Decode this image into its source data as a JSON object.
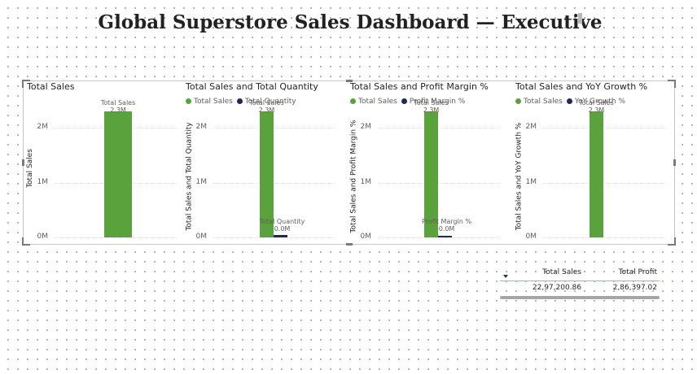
{
  "page": {
    "title": "Global Superstore Sales Dashboard — Executive"
  },
  "colors": {
    "sales": "#5aa33c",
    "secondary": "#1f2a56",
    "accent_line": "#9cc489"
  },
  "charts": [
    {
      "title": "Total Sales",
      "ylabel": "Total Sales",
      "legend": [],
      "ticks": [
        "2M",
        "1M",
        "0M"
      ],
      "bar_labels": [
        "Total Sales",
        "",
        ""
      ],
      "bar_values": [
        "2.3M",
        "",
        ""
      ]
    },
    {
      "title": "Total Sales and Total Quantity",
      "ylabel": "Total Sales and Total Quantity",
      "legend": [
        "Total Sales",
        "Total Quantity"
      ],
      "ticks": [
        "2M",
        "1M",
        "0M"
      ],
      "bar_labels": [
        "Total Sales",
        "Total Quantity",
        ""
      ],
      "bar_values": [
        "2.3M",
        "0.0M",
        ""
      ]
    },
    {
      "title": "Total Sales and Profit Margin %",
      "ylabel": "Total Sales and Profit Margin %",
      "legend": [
        "Total Sales",
        "Profit Margin %"
      ],
      "ticks": [
        "2M",
        "1M",
        "0M"
      ],
      "bar_labels": [
        "Total Sales",
        "Profit Margin %",
        ""
      ],
      "bar_values": [
        "2.3M",
        "0.0M",
        ""
      ]
    },
    {
      "title": "Total Sales and YoY Growth %",
      "ylabel": "Total Sales and YoY Growth %",
      "legend": [
        "Total Sales",
        "YoY Growth %"
      ],
      "ticks": [
        "2M",
        "1M",
        "0M"
      ],
      "bar_labels": [
        "Total Sales",
        "",
        ""
      ],
      "bar_values": [
        "2.3M",
        "",
        ""
      ]
    }
  ],
  "chart_data": [
    {
      "type": "bar",
      "title": "Total Sales",
      "ylabel": "Total Sales",
      "ylim": [
        0,
        2300000
      ],
      "series": [
        {
          "name": "Total Sales",
          "values": [
            2297200.86
          ]
        }
      ]
    },
    {
      "type": "bar",
      "title": "Total Sales and Total Quantity",
      "ylabel": "Total Sales and Total Quantity",
      "ylim": [
        0,
        2300000
      ],
      "series": [
        {
          "name": "Total Sales",
          "values": [
            2297200.86
          ]
        },
        {
          "name": "Total Quantity",
          "values": [
            38000
          ]
        }
      ]
    },
    {
      "type": "bar",
      "title": "Total Sales and Profit Margin %",
      "ylabel": "Total Sales and Profit Margin %",
      "ylim": [
        0,
        2300000
      ],
      "series": [
        {
          "name": "Total Sales",
          "values": [
            2297200.86
          ]
        },
        {
          "name": "Profit Margin %",
          "values": [
            0.12
          ]
        }
      ]
    },
    {
      "type": "bar",
      "title": "Total Sales and YoY Growth %",
      "ylabel": "Total Sales and YoY Growth %",
      "ylim": [
        0,
        2300000
      ],
      "series": [
        {
          "name": "Total Sales",
          "values": [
            2297200.86
          ]
        },
        {
          "name": "YoY Growth %",
          "values": [
            0
          ]
        }
      ]
    }
  ],
  "table": {
    "headers": [
      "Total Sales",
      "Total Profit"
    ],
    "rows": [
      [
        "22,97,200.86",
        "2,86,397.02"
      ]
    ]
  }
}
